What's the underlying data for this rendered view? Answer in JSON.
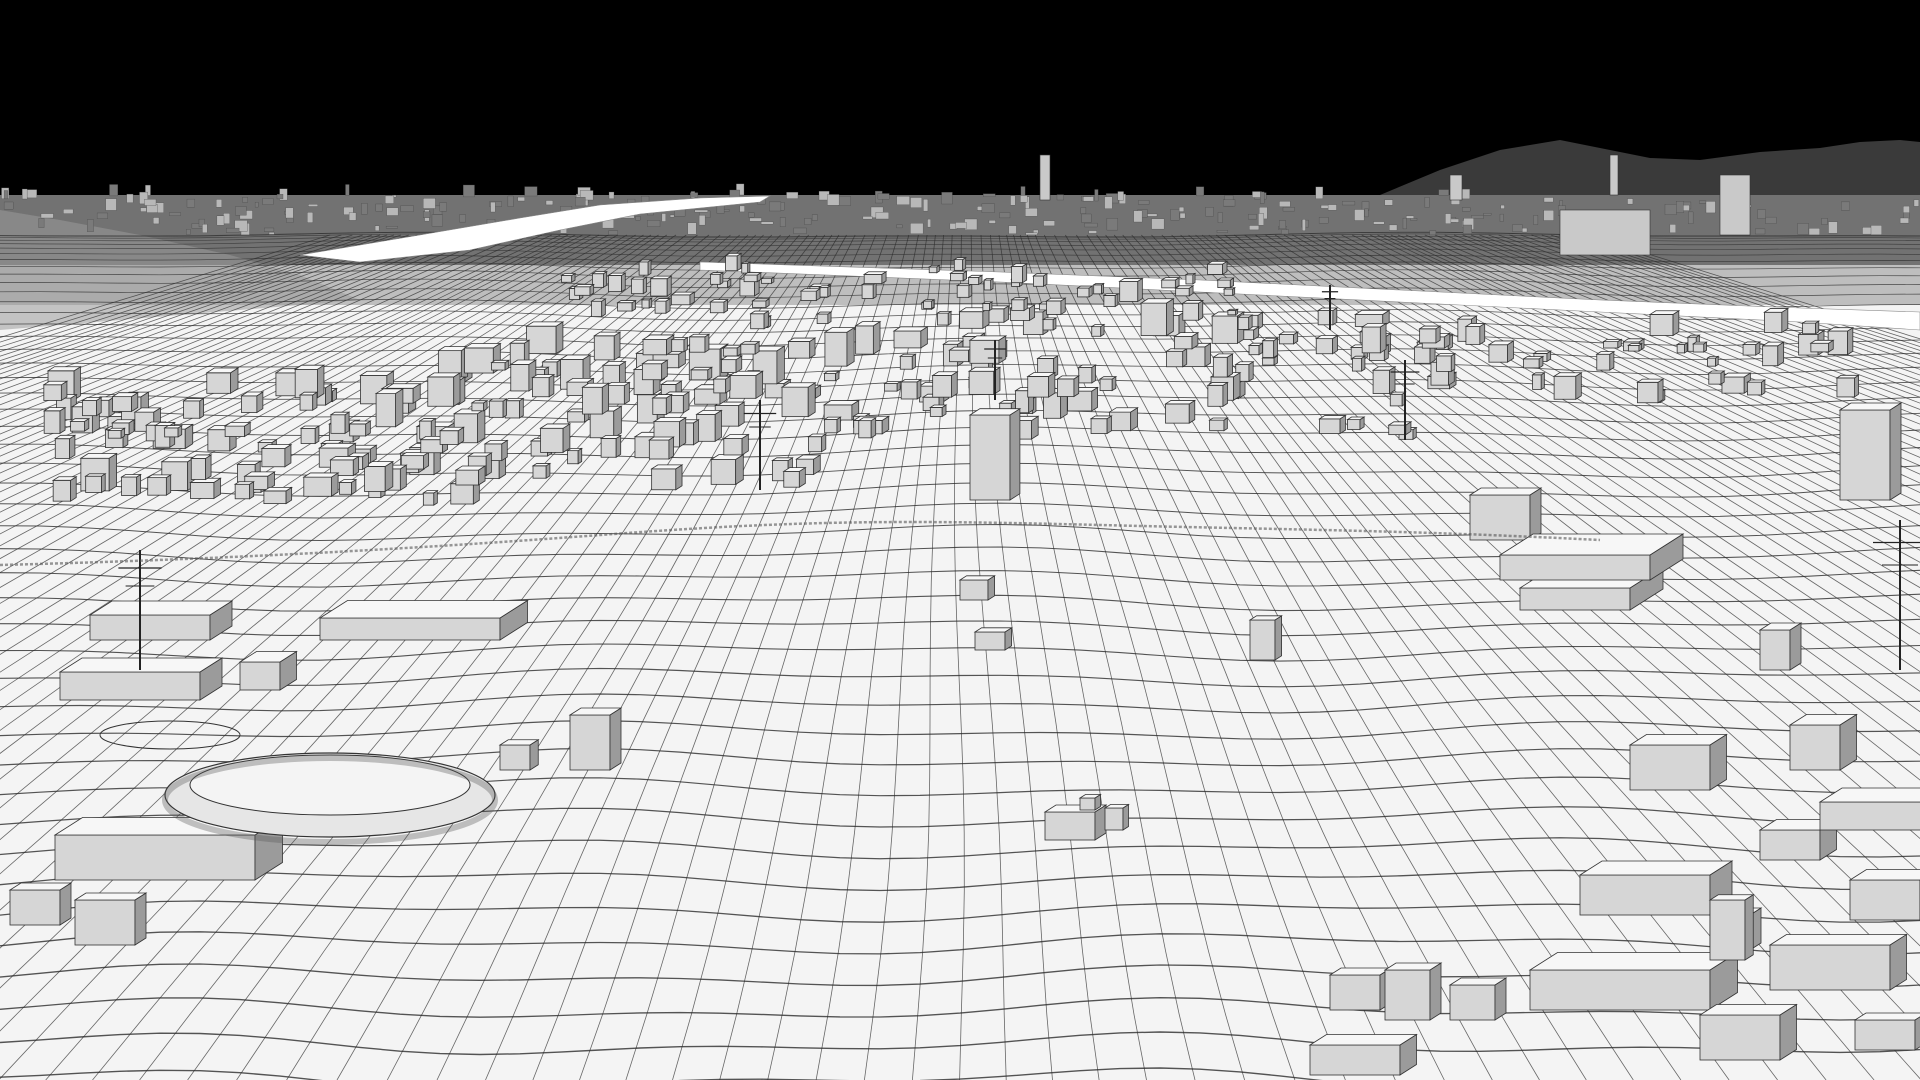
{
  "scene": {
    "subject": "wireframe-city-terrain-render",
    "colors": {
      "sky": "#000000",
      "ground": "#f4f4f4",
      "grid_line": "#2b2b2b",
      "far_terrain": "#5a5a5a",
      "mountain": "#3a3a3a",
      "building_top": "#f7f7f7",
      "building_front": "#d6d6d6",
      "building_side": "#9b9b9b",
      "building_edge": "#333333",
      "river": "#ffffff"
    }
  }
}
